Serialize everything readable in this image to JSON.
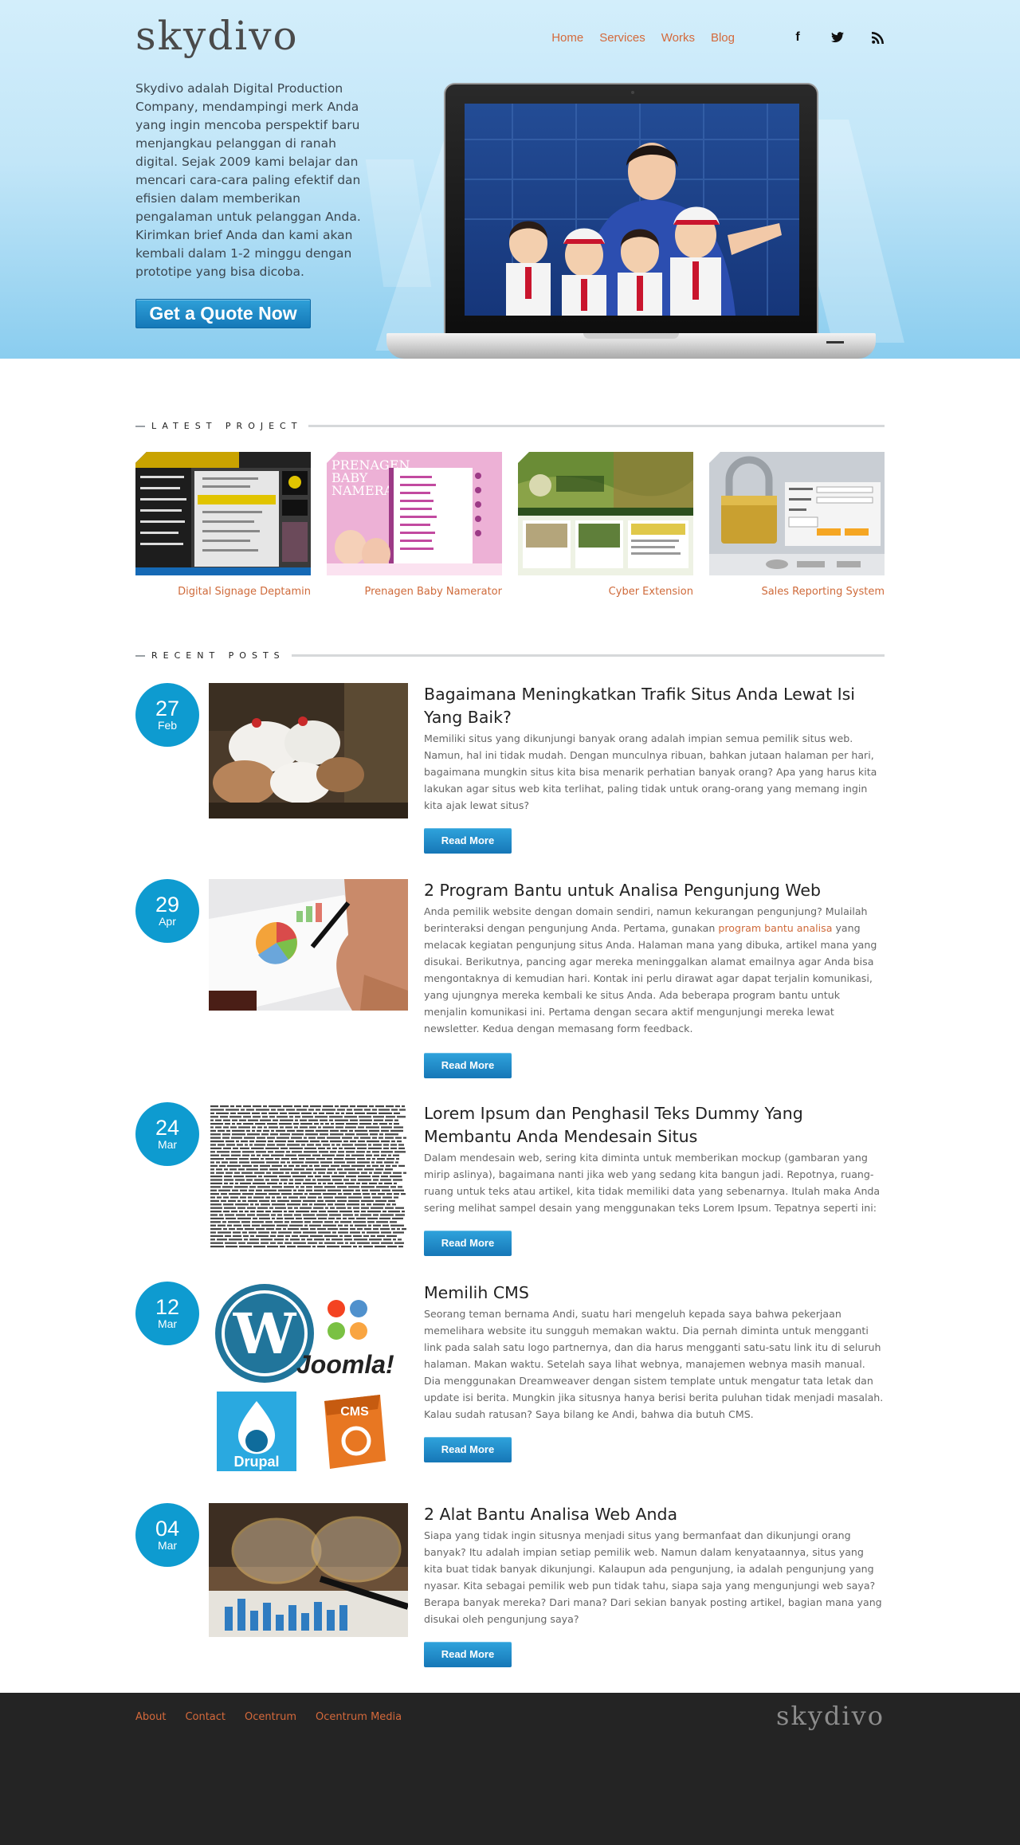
{
  "brand": {
    "logo_text": "skydivo"
  },
  "nav": {
    "items": [
      "Home",
      "Services",
      "Works",
      "Blog"
    ],
    "social": [
      "facebook-icon",
      "twitter-icon",
      "rss-icon"
    ]
  },
  "hero": {
    "intro": "Skydivo adalah Digital Production Company, mendampingi merk Anda yang ingin mencoba perspektif baru menjangkau pelanggan di ranah digital. Sejak 2009 kami belajar dan mencari cara-cara paling efektif dan efisien dalam memberikan pengalaman untuk pelanggan Anda. Kirimkan brief Anda dan kami akan kembali dalam 1-2 minggu dengan prototipe yang bisa dicoba.",
    "cta": "Get a Quote Now"
  },
  "latest_project": {
    "title": "LATEST PROJECT",
    "items": [
      {
        "label": "Digital Signage Deptamin"
      },
      {
        "label": "Prenagen Baby Namerator"
      },
      {
        "label": "Cyber Extension"
      },
      {
        "label": "Sales Reporting System"
      }
    ]
  },
  "recent_posts": {
    "title": "RECENT POSTS",
    "read_more": "Read More",
    "posts": [
      {
        "day": "27",
        "month": "Feb",
        "title": "Bagaimana Meningkatkan Trafik Situs Anda Lewat Isi Yang Baik?",
        "excerpt": "Memiliki situs yang dikunjungi banyak orang adalah impian semua pemilik situs web. Namun, hal ini tidak mudah. Dengan munculnya ribuan, bahkan jutaan halaman per hari, bagaimana mungkin situs kita bisa menarik perhatian banyak orang? Apa yang harus kita lakukan agar situs web kita terlihat, paling tidak untuk orang-orang yang memang ingin kita ajak lewat situs?"
      },
      {
        "day": "29",
        "month": "Apr",
        "title": "2 Program Bantu untuk Analisa Pengunjung Web",
        "excerpt_a": "Anda pemilik website dengan domain sendiri, namun kekurangan pengunjung? Mulailah berinteraksi dengan pengunjung Anda. Pertama, gunakan ",
        "excerpt_link": "program bantu analisa",
        "excerpt_b": " yang melacak kegiatan pengunjung situs Anda. Halaman mana yang dibuka, artikel mana yang disukai. Berikutnya, pancing agar mereka meninggalkan alamat emailnya agar Anda bisa mengontaknya di kemudian hari. Kontak ini perlu dirawat agar dapat terjalin komunikasi, yang ujungnya mereka kembali ke situs Anda. Ada beberapa program bantu untuk menjalin komunikasi ini. Pertama dengan secara aktif mengunjungi mereka lewat newsletter. Kedua dengan memasang form feedback."
      },
      {
        "day": "24",
        "month": "Mar",
        "title": "Lorem Ipsum dan Penghasil Teks Dummy Yang Membantu Anda Mendesain Situs",
        "excerpt": "Dalam mendesain web, sering kita diminta untuk memberikan mockup (gambaran yang mirip aslinya), bagaimana nanti jika web yang sedang kita bangun jadi. Repotnya, ruang-ruang untuk teks atau artikel, kita tidak memiliki data yang sebenarnya. Itulah maka Anda sering melihat sampel desain yang menggunakan teks Lorem Ipsum. Tepatnya seperti ini:"
      },
      {
        "day": "12",
        "month": "Mar",
        "title": "Memilih CMS",
        "excerpt": "Seorang teman bernama Andi, suatu hari mengeluh kepada saya bahwa pekerjaan memelihara website itu sungguh memakan waktu. Dia pernah diminta untuk mengganti link pada salah satu logo partnernya, dan dia harus mengganti satu-satu link itu di seluruh halaman. Makan waktu. Setelah saya lihat webnya, manajemen webnya masih manual. Dia menggunakan Dreamweaver dengan sistem template untuk mengatur tata letak dan update isi berita. Mungkin jika situsnya hanya berisi berita puluhan tidak menjadi masalah. Kalau sudah ratusan? Saya bilang ke Andi, bahwa dia butuh CMS.",
        "logos": [
          "Joomla!",
          "Drupal",
          "CMS"
        ]
      },
      {
        "day": "04",
        "month": "Mar",
        "title": "2 Alat Bantu Analisa Web Anda",
        "excerpt": "Siapa yang tidak ingin situsnya menjadi situs yang bermanfaat dan dikunjungi orang banyak? Itu adalah impian setiap pemilik web. Namun dalam kenyataannya, situs yang kita buat tidak banyak dikunjungi. Kalaupun ada pengunjung, ia adalah pengunjung yang nyasar. Kita sebagai pemilik web pun tidak tahu, siapa saja yang mengunjungi web saya? Berapa banyak mereka? Dari mana? Dari sekian banyak posting artikel, bagian mana yang disukai oleh pengunjung saya?"
      }
    ]
  },
  "footer": {
    "links": [
      "About",
      "Contact",
      "Ocentrum",
      "Ocentrum Media"
    ],
    "logo_text": "skydivo"
  },
  "colors": {
    "accent": "#d4693b",
    "primary_blue": "#0e9bd0",
    "footer_bg": "#242424"
  }
}
